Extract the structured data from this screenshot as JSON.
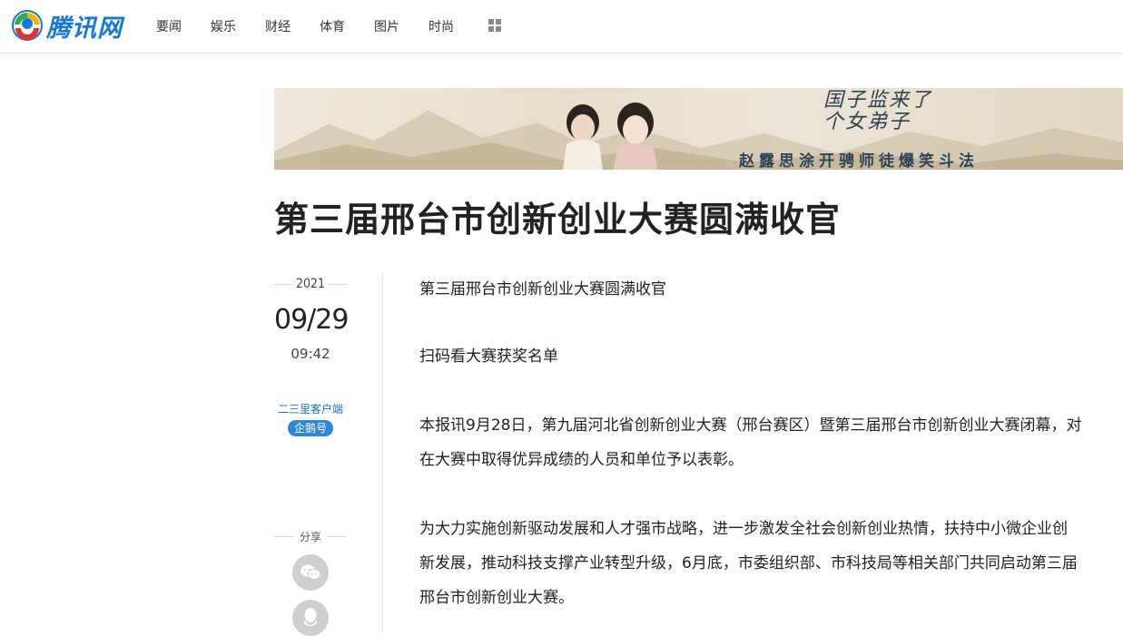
{
  "site": {
    "logo_text": "腾讯网"
  },
  "nav": {
    "items": [
      "要闻",
      "娱乐",
      "财经",
      "体育",
      "图片",
      "时尚"
    ],
    "more_icon": "grid-icon"
  },
  "banner": {
    "seal_text": "国子监来了个女弟子",
    "slogan": "赵露思涂开骋师徒爆笑斗法"
  },
  "article": {
    "title": "第三届邢台市创新创业大赛圆满收官",
    "paragraphs": [
      "第三届邢台市创新创业大赛圆满收官",
      "扫码看大赛获奖名单",
      "本报讯9月28日，第九届河北省创新创业大赛（邢台赛区）暨第三届邢台市创新创业大赛闭幕，对在大赛中取得优异成绩的人员和单位予以表彰。",
      "为大力实施创新驱动发展和人才强市战略，进一步激发全社会创新创业热情，扶持中小微企业创新发展，推动科技支撑产业转型升级，6月底，市委组织部、市科技局等相关部门共同启动第三届邢台市创新创业大赛。"
    ]
  },
  "meta": {
    "year": "2021",
    "date": "09/29",
    "time": "09:42",
    "source": "二三里客户端",
    "badge": "企鹅号",
    "share_label": "分享",
    "share_icons": [
      "wechat-icon",
      "qq-icon"
    ]
  },
  "colors": {
    "logo_blue": "#1479d7",
    "badge_blue": "#2c87d9",
    "source_blue": "#1a6fc4"
  }
}
